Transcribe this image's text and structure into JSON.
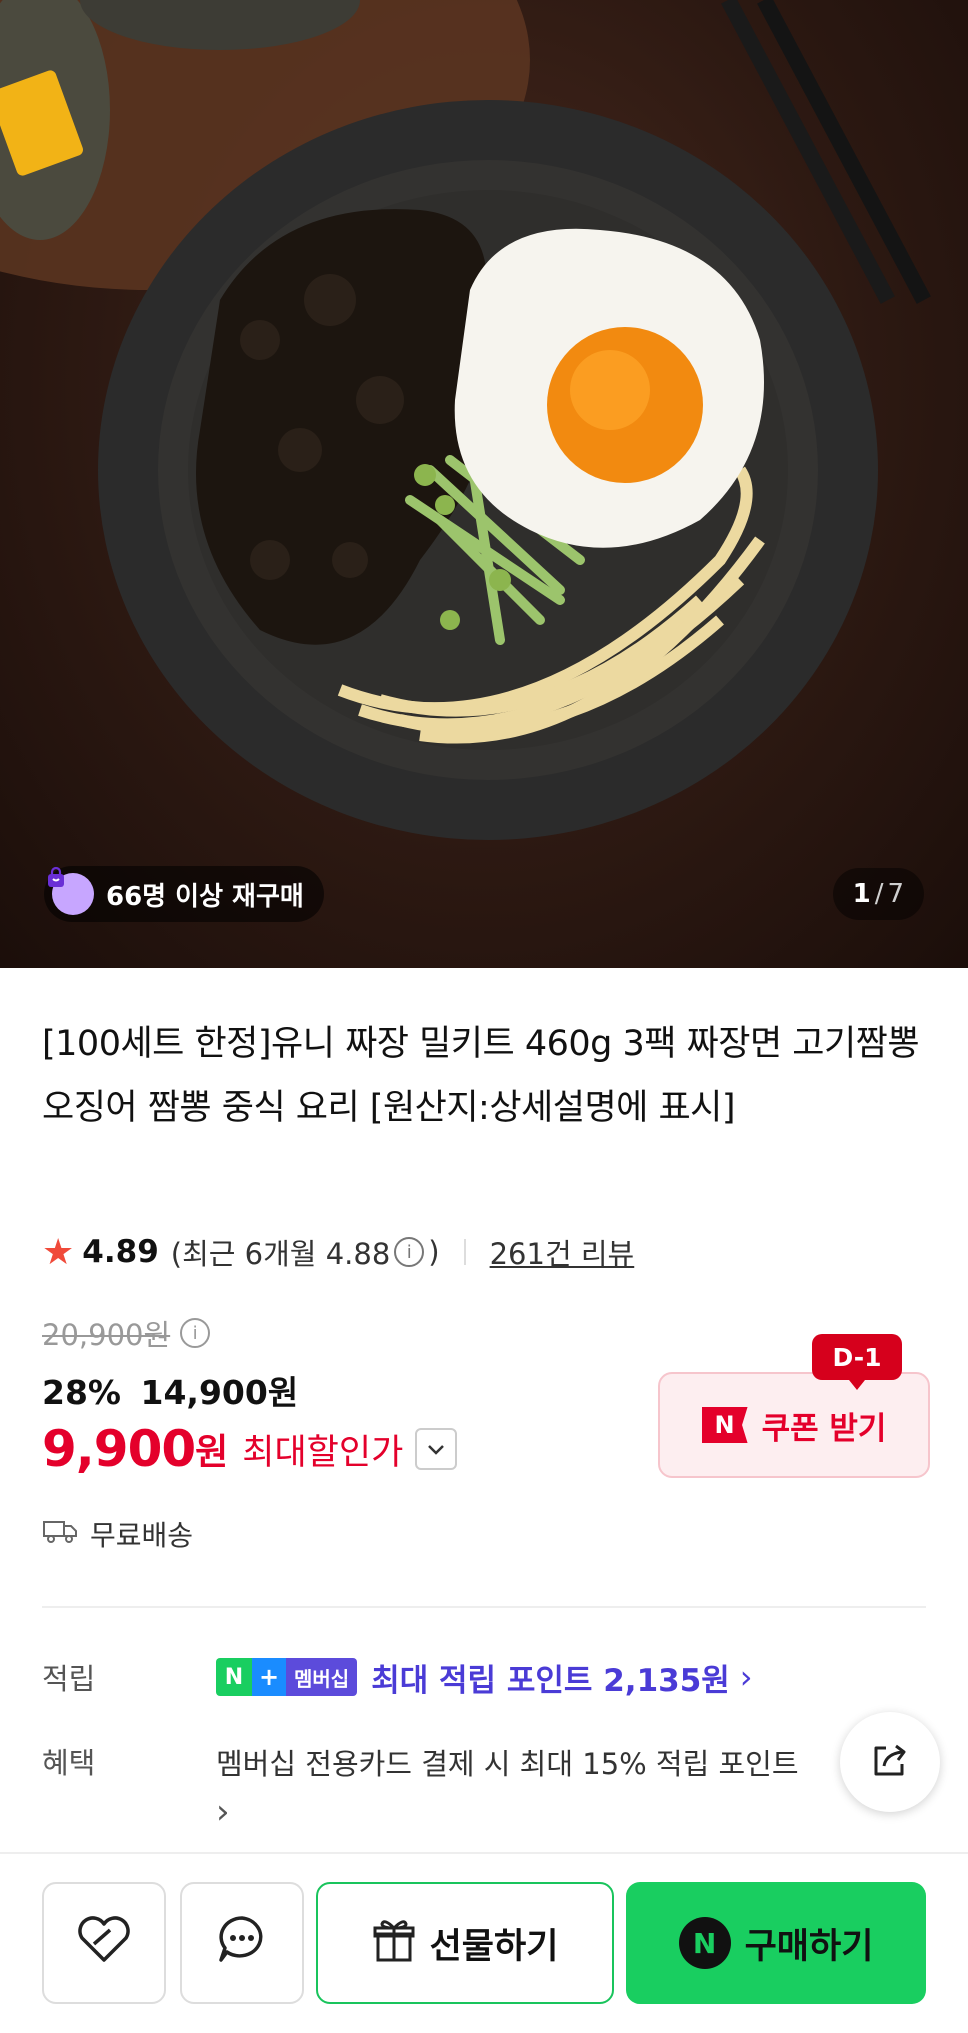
{
  "gallery": {
    "badge_label": "66명 이상 재구매",
    "current_page": "1",
    "separator": "/",
    "total_pages": "7"
  },
  "product": {
    "title": "[100세트 한정]유니 짜장 밀키트 460g 3팩 짜장면 고기짬뽕 오징어 짬뽕 중식 요리 [원산지:상세설명에 표시]",
    "rating": "4.89",
    "recent_rating_prefix": "(최근 6개월 4.88",
    "recent_rating_suffix": ")",
    "review_count": "261건 리뷰",
    "original_price": "20,900원",
    "discount_percent": "28%",
    "sale_price": "14,900원",
    "max_discount_price": "9,900",
    "max_discount_unit": "원",
    "max_discount_label": "최대할인가",
    "shipping": "무료배송"
  },
  "coupon": {
    "dday": "D-1",
    "logo_letter": "N",
    "label": "쿠폰 받기"
  },
  "points": {
    "label": "적립",
    "badge_n": "N",
    "badge_plus": "+",
    "badge_membership": "멤버십",
    "text": "최대 적립 포인트 2,135원"
  },
  "benefit": {
    "label": "혜택",
    "text": "멤버십 전용카드 결제 시 최대 15% 적립 포인트"
  },
  "bottom_bar": {
    "gift_label": "선물하기",
    "buy_logo": "N",
    "buy_label": "구매하기"
  },
  "colors": {
    "accent_red": "#e4002b",
    "naver_green": "#19ce60",
    "point_purple": "#4a3bd6"
  }
}
